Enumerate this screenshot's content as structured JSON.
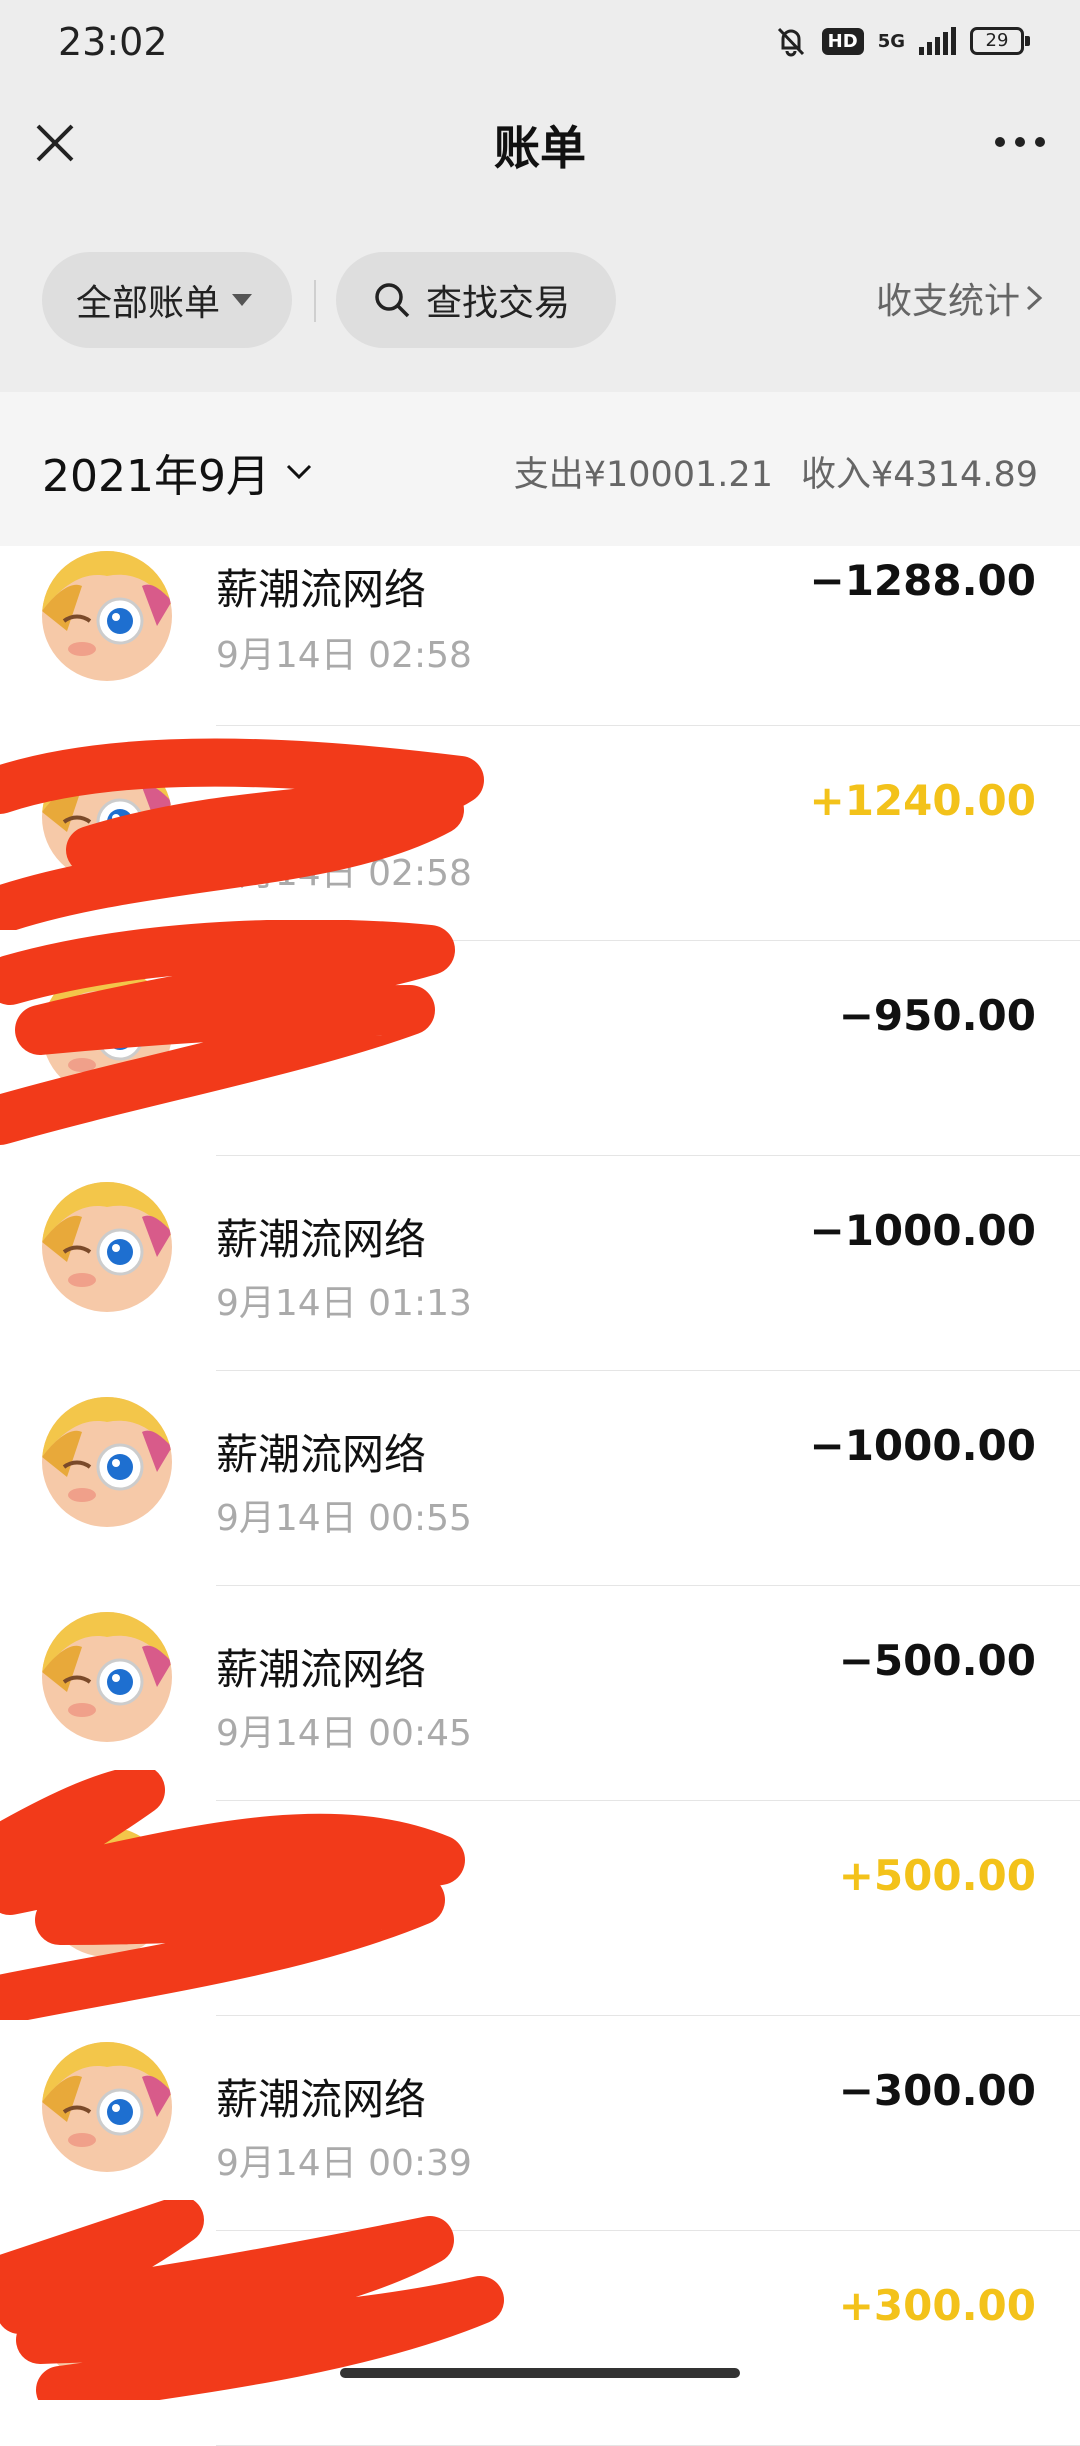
{
  "status_bar": {
    "time": "23:02",
    "hd": "HD",
    "network": "5G",
    "battery": "29"
  },
  "nav": {
    "title": "账单"
  },
  "filters": {
    "all_bills": "全部账单",
    "search": "查找交易",
    "stats": "收支统计"
  },
  "month": {
    "label": "2021年9月",
    "expense": "支出¥10001.21",
    "income": "收入¥4314.89"
  },
  "transactions": [
    {
      "name": "薪潮流网络",
      "time": "9月14日 02:58",
      "amount": "−1288.00",
      "type": "expense"
    },
    {
      "name": "",
      "time": "9月14日 02:58",
      "amount": "+1240.00",
      "type": "income"
    },
    {
      "name": "",
      "time": "",
      "amount": "−950.00",
      "type": "expense"
    },
    {
      "name": "薪潮流网络",
      "time": "9月14日 01:13",
      "amount": "−1000.00",
      "type": "expense"
    },
    {
      "name": "薪潮流网络",
      "time": "9月14日 00:55",
      "amount": "−1000.00",
      "type": "expense"
    },
    {
      "name": "薪潮流网络",
      "time": "9月14日 00:45",
      "amount": "−500.00",
      "type": "expense"
    },
    {
      "name": "",
      "time": "",
      "amount": "+500.00",
      "type": "income"
    },
    {
      "name": "薪潮流网络",
      "time": "9月14日 00:39",
      "amount": "−300.00",
      "type": "expense"
    },
    {
      "name": "",
      "time": "",
      "amount": "+300.00",
      "type": "income"
    }
  ],
  "colors": {
    "income": "#f3c21a",
    "expense": "#111111",
    "redaction": "#f23a1a"
  }
}
